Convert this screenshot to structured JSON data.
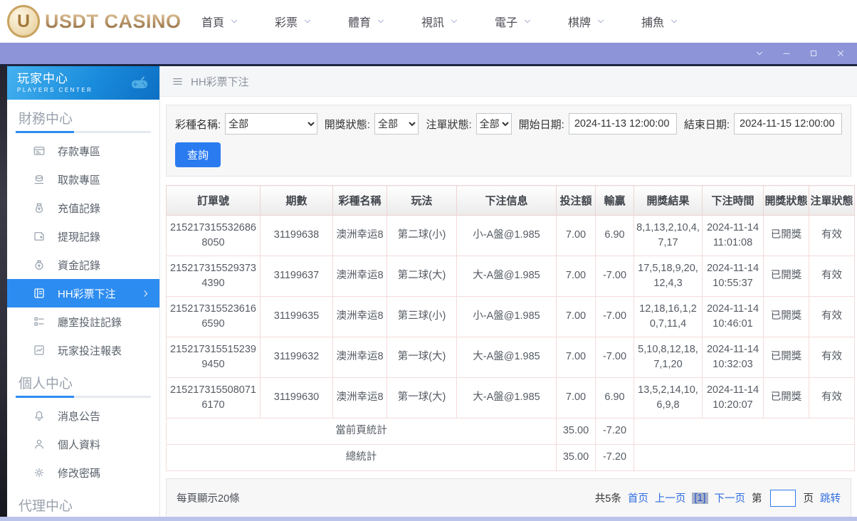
{
  "colors": {
    "accent_blue": "#2d8cf0",
    "button_blue": "#2b7bf0",
    "link_blue": "#2d6ce0",
    "titlebar_lavender": "#8d94d8",
    "sidebar_header_blue": "#1a8cdc",
    "table_border_pink": "#f5dbdb",
    "logo_gold": "#b08a4f"
  },
  "header": {
    "logo_badge": "U",
    "logo_text": "USDT CASINO",
    "nav": [
      {
        "id": "home",
        "label": "首頁"
      },
      {
        "id": "lottery",
        "label": "彩票"
      },
      {
        "id": "sports",
        "label": "體育"
      },
      {
        "id": "live-video",
        "label": "視訊"
      },
      {
        "id": "electronic",
        "label": "電子"
      },
      {
        "id": "chess",
        "label": "棋牌"
      },
      {
        "id": "fishing",
        "label": "捕魚"
      }
    ]
  },
  "sidebar": {
    "title": "玩家中心",
    "subtitle": "PLAYERS CENTER",
    "sections": [
      {
        "title": "財務中心",
        "items": [
          {
            "id": "deposit",
            "label": "存款專區",
            "icon": "deposit-icon",
            "selected": false
          },
          {
            "id": "withdraw",
            "label": "取款專區",
            "icon": "withdraw-icon",
            "selected": false
          },
          {
            "id": "recharge-record",
            "label": "充值記錄",
            "icon": "recharge-record-icon",
            "selected": false
          },
          {
            "id": "withdrawal-record",
            "label": "提現記錄",
            "icon": "withdrawal-record-icon",
            "selected": false
          },
          {
            "id": "funds-record",
            "label": "資金記錄",
            "icon": "funds-record-icon",
            "selected": false
          },
          {
            "id": "hh-lottery-bets",
            "label": "HH彩票下注",
            "icon": "lottery-bet-icon",
            "selected": true
          },
          {
            "id": "room-bet-record",
            "label": "廳室投註記錄",
            "icon": "room-bet-record-icon",
            "selected": false
          },
          {
            "id": "player-bet-report",
            "label": "玩家投注報表",
            "icon": "player-bet-report-icon",
            "selected": false
          }
        ]
      },
      {
        "title": "個人中心",
        "items": [
          {
            "id": "announcements",
            "label": "消息公告",
            "icon": "bell-icon",
            "selected": false
          },
          {
            "id": "profile",
            "label": "個人資料",
            "icon": "person-icon",
            "selected": false
          },
          {
            "id": "change-password",
            "label": "修改密碼",
            "icon": "gear-icon",
            "selected": false
          }
        ]
      },
      {
        "title": "代理中心",
        "items": []
      }
    ]
  },
  "main": {
    "breadcrumb": "HH彩票下注",
    "filters": {
      "lottery_label": "彩種名稱:",
      "lottery_value": "全部",
      "draw_status_label": "開獎狀態:",
      "draw_status_value": "全部",
      "order_status_label": "注單狀態:",
      "order_status_value": "全部",
      "start_label": "開始日期:",
      "start_value": "2024-11-13 12:00:00",
      "end_label": "結束日期:",
      "end_value": "2024-11-15 12:00:00",
      "query_button": "查詢"
    },
    "table": {
      "columns": [
        "訂單號",
        "期數",
        "彩種名稱",
        "玩法",
        "下注信息",
        "投注額",
        "輸贏",
        "開獎結果",
        "下注時間",
        "開獎狀態",
        "注單狀態"
      ],
      "rows": [
        [
          "2152173155326868050",
          "31199638",
          "澳洲幸运8",
          "第二球(小)",
          "小-A盤@1.985",
          "7.00",
          "6.90",
          "8,1,13,2,10,4,7,17",
          "2024-11-14 11:01:08",
          "已開獎",
          "有效"
        ],
        [
          "2152173155293734390",
          "31199637",
          "澳洲幸运8",
          "第二球(大)",
          "大-A盤@1.985",
          "7.00",
          "-7.00",
          "17,5,18,9,20,12,4,3",
          "2024-11-14 10:55:37",
          "已開獎",
          "有效"
        ],
        [
          "2152173155236166590",
          "31199635",
          "澳洲幸运8",
          "第三球(小)",
          "小-A盤@1.985",
          "7.00",
          "-7.00",
          "12,18,16,1,20,7,11,4",
          "2024-11-14 10:46:01",
          "已開獎",
          "有效"
        ],
        [
          "2152173155152399450",
          "31199632",
          "澳洲幸运8",
          "第一球(大)",
          "大-A盤@1.985",
          "7.00",
          "-7.00",
          "5,10,8,12,18,7,1,20",
          "2024-11-14 10:32:03",
          "已開獎",
          "有效"
        ],
        [
          "2152173155080716170",
          "31199630",
          "澳洲幸运8",
          "第一球(大)",
          "大-A盤@1.985",
          "7.00",
          "6.90",
          "13,5,2,14,10,6,9,8",
          "2024-11-14 10:20:07",
          "已開獎",
          "有效"
        ]
      ],
      "summary_rows": [
        {
          "label": "當前頁統計",
          "bet_total": "35.00",
          "win_loss": "-7.20"
        },
        {
          "label": "總統計",
          "bet_total": "35.00",
          "win_loss": "-7.20"
        }
      ]
    },
    "pagination": {
      "page_size_text": "每頁顯示20條",
      "total_text": "共5条",
      "first_label": "首页",
      "prev_label": "上一页",
      "current_page": "[1]",
      "next_label": "下一页",
      "jump_prefix": "第",
      "jump_suffix": "页",
      "jump_label": "跳转",
      "jump_value": ""
    }
  }
}
